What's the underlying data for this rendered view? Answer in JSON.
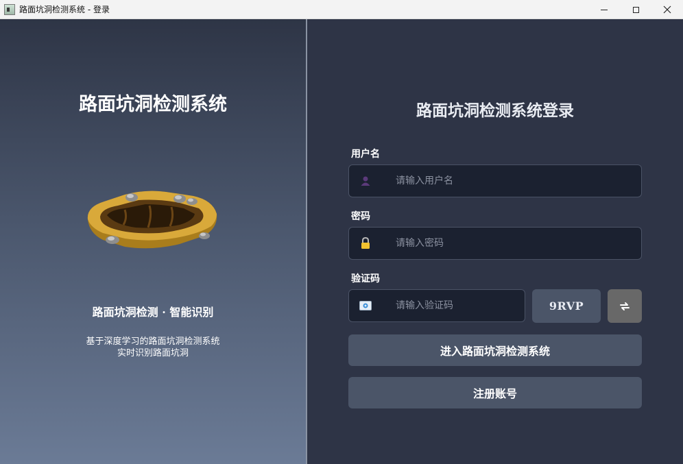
{
  "window": {
    "title": "路面坑洞检测系统 - 登录"
  },
  "left_panel": {
    "title": "路面坑洞检测系统",
    "tagline": "路面坑洞检测 · 智能识别",
    "description_line1": "基于深度学习的路面坑洞检测系统",
    "description_line2": "实时识别路面坑洞"
  },
  "form": {
    "title": "路面坑洞检测系统登录",
    "username": {
      "label": "用户名",
      "placeholder": "请输入用户名",
      "value": "",
      "icon": "user-icon"
    },
    "password": {
      "label": "密码",
      "placeholder": "请输入密码",
      "value": "",
      "icon": "lock-icon"
    },
    "captcha": {
      "label": "验证码",
      "placeholder": "请输入验证码",
      "value": "",
      "icon": "id-card-icon",
      "code": "9RVP",
      "refresh_icon": "refresh-icon"
    },
    "login_button": "进入路面坑洞检测系统",
    "register_button": "注册账号"
  },
  "colors": {
    "panel_bg": "#2e3446",
    "input_bg": "#1b2130",
    "button_bg": "#4b5568",
    "refresh_bg": "#686868"
  }
}
